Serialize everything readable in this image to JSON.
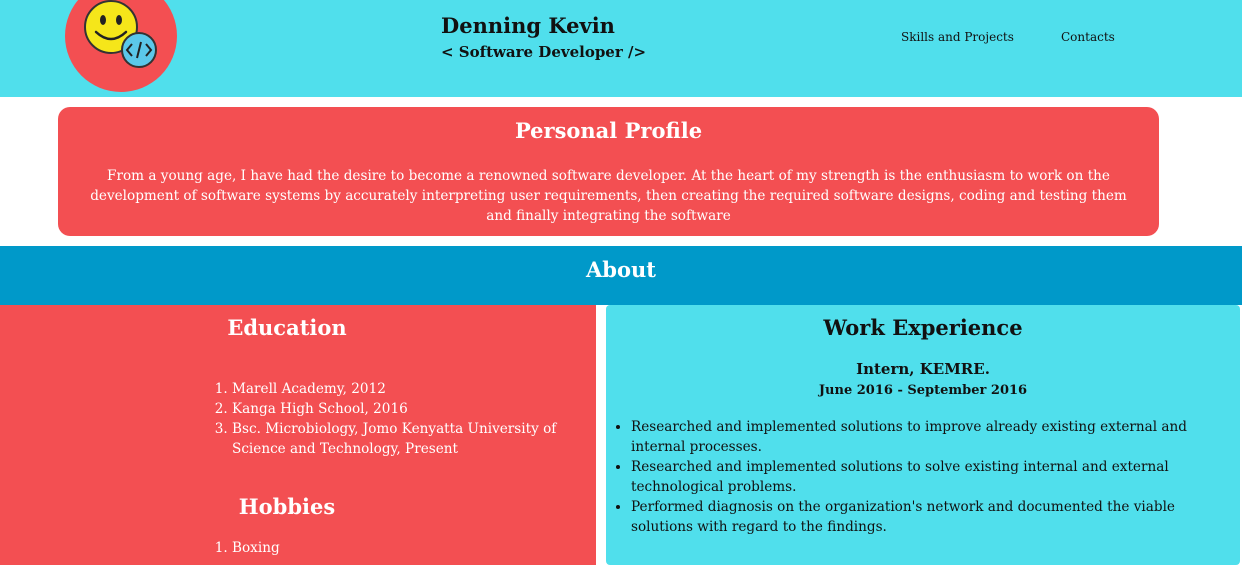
{
  "header": {
    "name": "Denning Kevin",
    "role": "< Software Developer />",
    "nav": [
      {
        "label": "Skills and Projects"
      },
      {
        "label": "Contacts"
      }
    ],
    "logo_icon": "smiley-code-icon"
  },
  "profile": {
    "title": "Personal Profile",
    "text": "From a young age, I have had the desire to become a renowned software developer. At the heart of my strength is the enthusiasm to work on the development of software systems by accurately interpreting user requirements, then creating the required software designs, coding and testing them and finally integrating the software"
  },
  "about": {
    "title": "About"
  },
  "education": {
    "title": "Education",
    "items": [
      "Marell Academy, 2012",
      "Kanga High School, 2016",
      "Bsc. Microbiology, Jomo Kenyatta University of Science and Technology, Present"
    ],
    "hobbies_title": "Hobbies",
    "hobbies": [
      "Boxing"
    ]
  },
  "work": {
    "title": "Work Experience",
    "job": "Intern, KEMRE.",
    "dates": "June 2016 - September 2016",
    "items": [
      "Researched and implemented solutions to improve already existing external and internal processes.",
      "Researched and implemented solutions to solve existing internal and external technological problems.",
      "Performed diagnosis on the organization's network and documented the viable solutions with regard to the findings."
    ]
  },
  "colors": {
    "header_bg": "#50dfec",
    "accent_red": "#f34f52",
    "about_blue": "#0099c9"
  }
}
